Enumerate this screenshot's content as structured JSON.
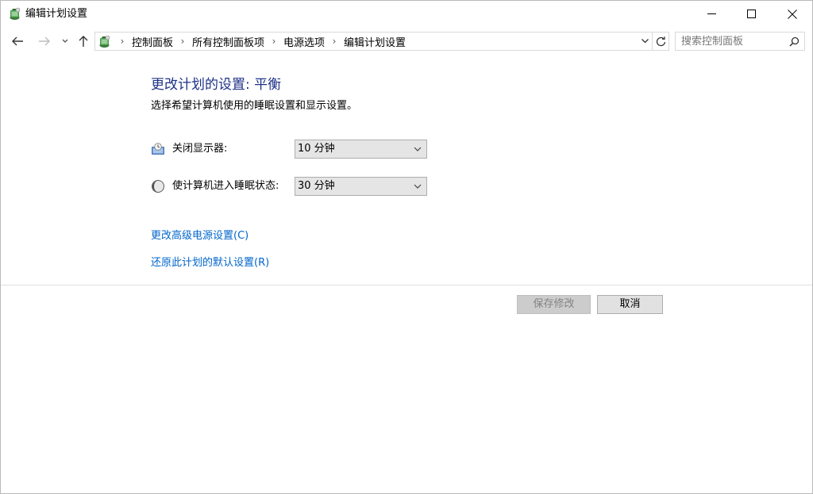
{
  "window": {
    "title": "编辑计划设置",
    "icon": "power-options-icon"
  },
  "nav": {
    "breadcrumbs": [
      "控制面板",
      "所有控制面板项",
      "电源选项",
      "编辑计划设置"
    ],
    "search_placeholder": "搜索控制面板"
  },
  "main": {
    "title": "更改计划的设置: 平衡",
    "description": "选择希望计算机使用的睡眠设置和显示设置。",
    "settings": [
      {
        "label": "关闭显示器:",
        "value": "10 分钟",
        "icon": "monitor-icon"
      },
      {
        "label": "使计算机进入睡眠状态:",
        "value": "30 分钟",
        "icon": "sleep-moon-icon"
      }
    ],
    "links": {
      "advanced": "更改高级电源设置(C)",
      "restore": "还原此计划的默认设置(R)"
    }
  },
  "buttons": {
    "save": "保存修改",
    "cancel": "取消"
  },
  "colors": {
    "title": "#1e3287",
    "link": "#0066cc"
  }
}
